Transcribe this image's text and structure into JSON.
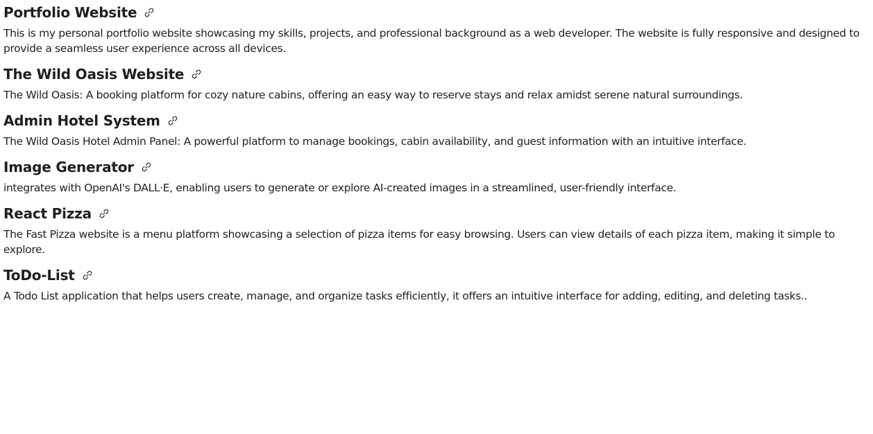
{
  "projects": [
    {
      "title": "Portfolio Website",
      "link_icon": "link-icon",
      "description": "This is my personal portfolio website showcasing my skills, projects, and professional background as a web developer. The website is fully responsive and designed to provide a seamless user experience across all devices."
    },
    {
      "title": "The Wild Oasis Website",
      "link_icon": "link-icon",
      "description": "The Wild Oasis: A booking platform for cozy nature cabins, offering an easy way to reserve stays and relax amidst serene natural surroundings."
    },
    {
      "title": "Admin Hotel System",
      "link_icon": "link-icon",
      "description": "The Wild Oasis Hotel Admin Panel: A powerful platform to manage bookings, cabin availability, and guest information with an intuitive interface."
    },
    {
      "title": "Image Generator",
      "link_icon": "link-icon",
      "description": "integrates with OpenAI's DALL·E, enabling users to generate or explore AI-created images in a streamlined, user-friendly interface."
    },
    {
      "title": "React Pizza",
      "link_icon": "link-icon",
      "description": "The Fast Pizza website is a menu platform showcasing a selection of pizza items for easy browsing. Users can view details of each pizza item, making it simple to explore."
    },
    {
      "title": "ToDo-List",
      "link_icon": "link-icon",
      "description": "A Todo List application that helps users create, manage, and organize tasks efficiently, it offers an intuitive interface for adding, editing, and deleting tasks.."
    }
  ],
  "colors": {
    "text": "#1f1f1f",
    "background": "#ffffff"
  }
}
